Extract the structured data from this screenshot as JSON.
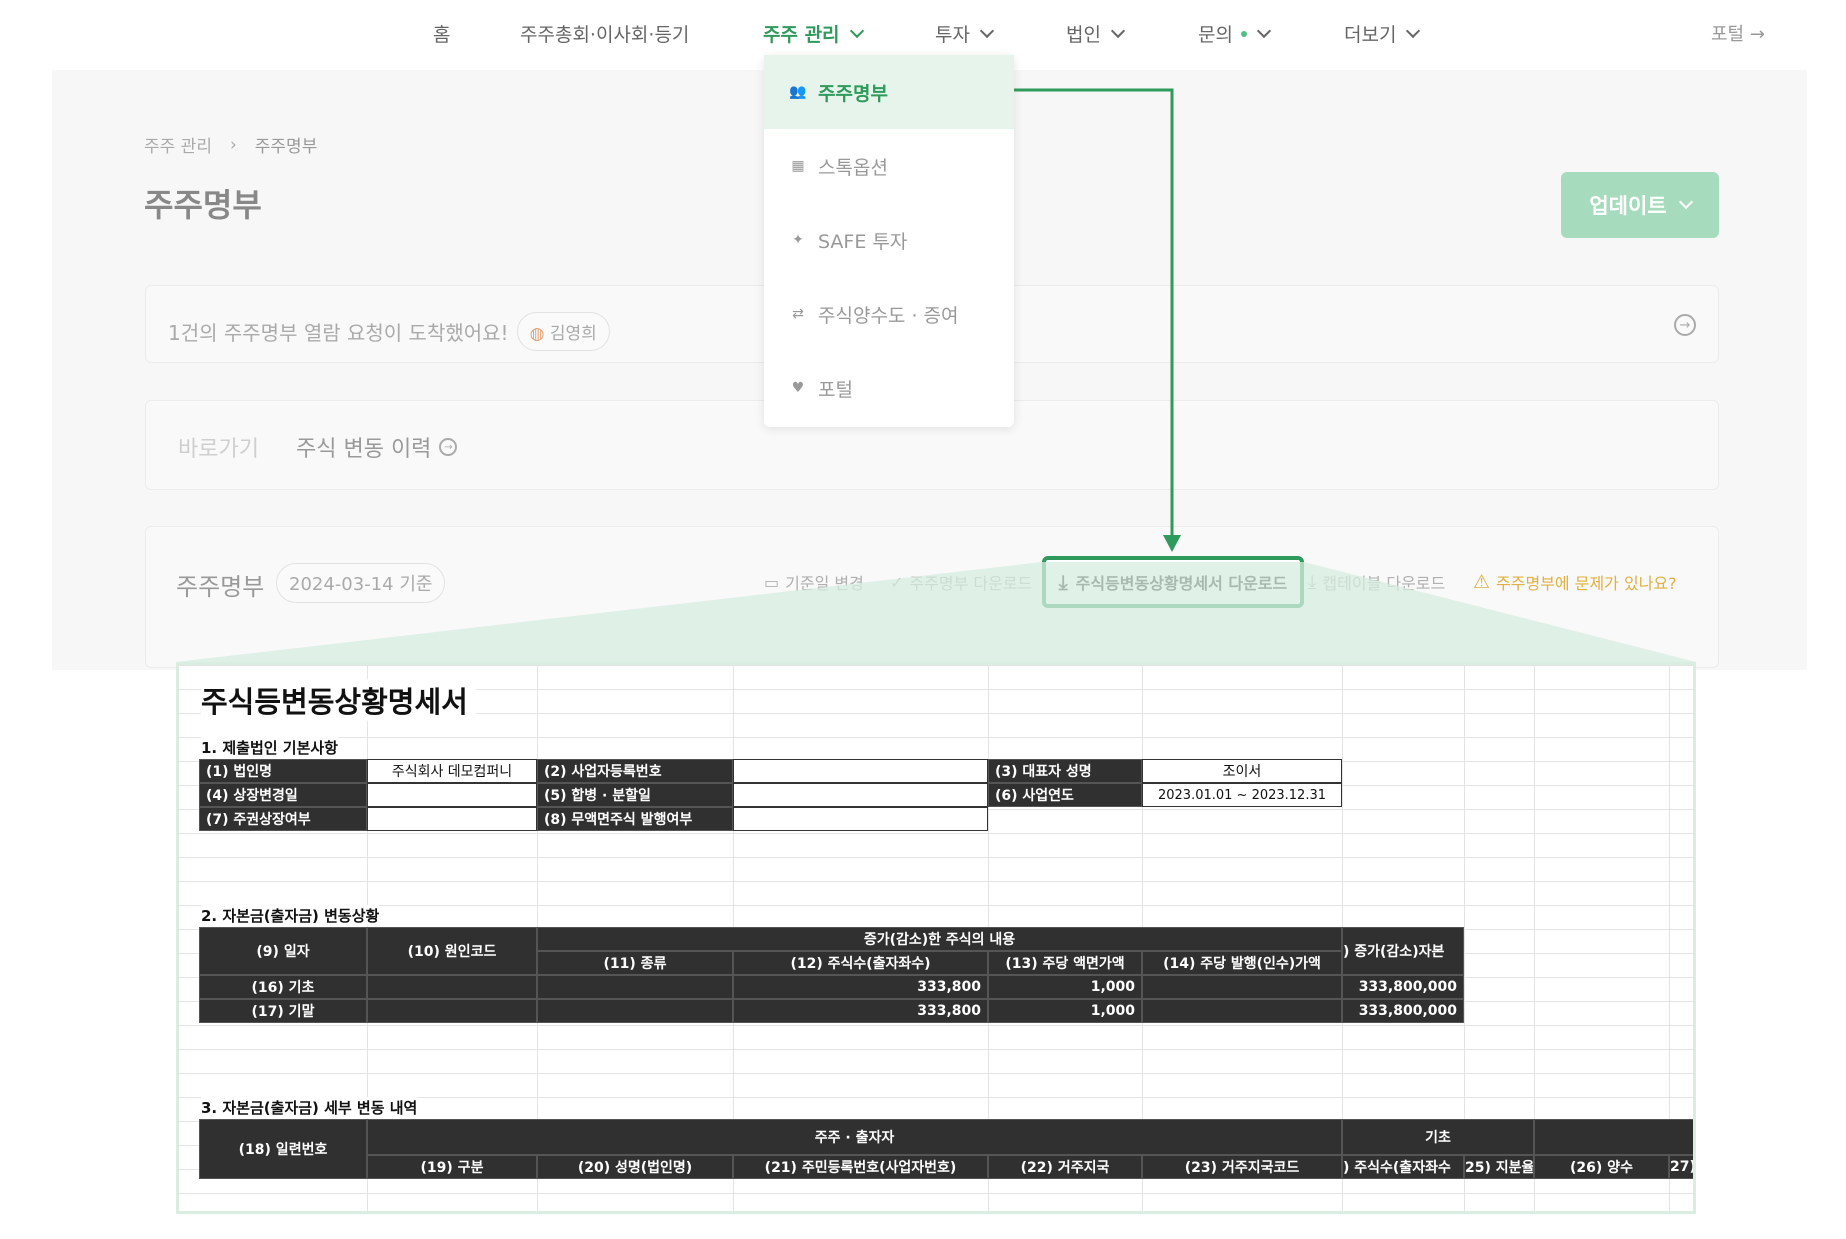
{
  "nav": {
    "items": [
      {
        "label": "홈",
        "dropdown": false
      },
      {
        "label": "주주총회·이사회·등기",
        "dropdown": false
      },
      {
        "label": "주주 관리",
        "dropdown": true,
        "active": true
      },
      {
        "label": "투자",
        "dropdown": true
      },
      {
        "label": "법인",
        "dropdown": true
      },
      {
        "label": "문의",
        "dropdown": true,
        "dot": true
      },
      {
        "label": "더보기",
        "dropdown": true
      }
    ],
    "portal": "포털 →"
  },
  "dropdown": {
    "items": [
      {
        "label": "주주명부",
        "icon": "users-icon"
      },
      {
        "label": "스톡옵션",
        "icon": "gift-icon"
      },
      {
        "label": "SAFE 투자",
        "icon": "sparkle-icon"
      },
      {
        "label": "주식양수도 · 증여",
        "icon": "transfer-icon"
      },
      {
        "label": "포털",
        "icon": "heart-icon"
      }
    ]
  },
  "breadcrumb": {
    "parent": "주주 관리",
    "sep": "›",
    "current": "주주명부"
  },
  "page_title": "주주명부",
  "update_button": "업데이트",
  "notice": {
    "text": "1건의 주주명부 열람 요청이 도착했어요!",
    "user": "김영희"
  },
  "shortcut": {
    "label": "바로가기",
    "link": "주식 변동 이력"
  },
  "register": {
    "title": "주주명부",
    "date_badge": "2024-03-14 기준",
    "actions": {
      "change_date": "기준일 변경",
      "download_register": "주주명부 다운로드",
      "download_statement": "주식등변동상황명세서 다운로드",
      "download_captable": "캡테이블 다운로드",
      "report_issue": "주주명부에 문제가 있나요?"
    }
  },
  "colors": {
    "accent": "#2e9a5b",
    "accent_light": "#a6dcbd",
    "warning": "#e0b040"
  },
  "sheet": {
    "title": "주식등변동상황명세서",
    "sec1": "1. 제출법인 기본사항",
    "corp_name_label": "(1) 법인명",
    "corp_name": "주식회사 데모컴퍼니",
    "biz_no_label": "(2) 사업자등록번호",
    "ceo_label": "(3) 대표자 성명",
    "ceo": "조이서",
    "listing_change_label": "(4) 상장변경일",
    "merger_label": "(5) 합병 · 분할일",
    "fiscal_year_label": "(6) 사업연도",
    "fiscal_year": "2023.01.01 ~ 2023.12.31",
    "listed_label": "(7) 주권상장여부",
    "no_par_label": "(8) 무액면주식 발행여부",
    "sec2": "2. 자본금(출자금) 변동상황",
    "h_date": "(9) 일자",
    "h_cause": "(10) 원인코드",
    "h_group": "증가(감소)한 주식의 내용",
    "h_kind": "(11) 종류",
    "h_shares": "(12) 주식수(출자좌수)",
    "h_par": "(13) 주당 액면가액",
    "h_issue": "(14) 주당 발행(인수)가액",
    "h_capital": ") 증가(감소)자본",
    "row_base": {
      "label": "(16) 기초",
      "shares": "333,800",
      "par": "1,000",
      "capital": "333,800,000"
    },
    "row_end": {
      "label": "(17) 기말",
      "shares": "333,800",
      "par": "1,000",
      "capital": "333,800,000"
    },
    "sec3": "3. 자본금(출자금) 세부 변동 내역",
    "h_serial": "(18) 일련번호",
    "h_holder": "주주 · 출자자",
    "h_base": "기초",
    "h_type": "(19) 구분",
    "h_name": "(20) 성명(법인명)",
    "h_id": "(21) 주민등록번호(사업자번호)",
    "h_country": "(22) 거주지국",
    "h_country_code": "(23) 거주지국코드",
    "h_base_shares": ") 주식수(출자좌수",
    "h_ratio": "25) 지분율",
    "h_transfer": "(26) 양수",
    "h_27": "27)"
  }
}
